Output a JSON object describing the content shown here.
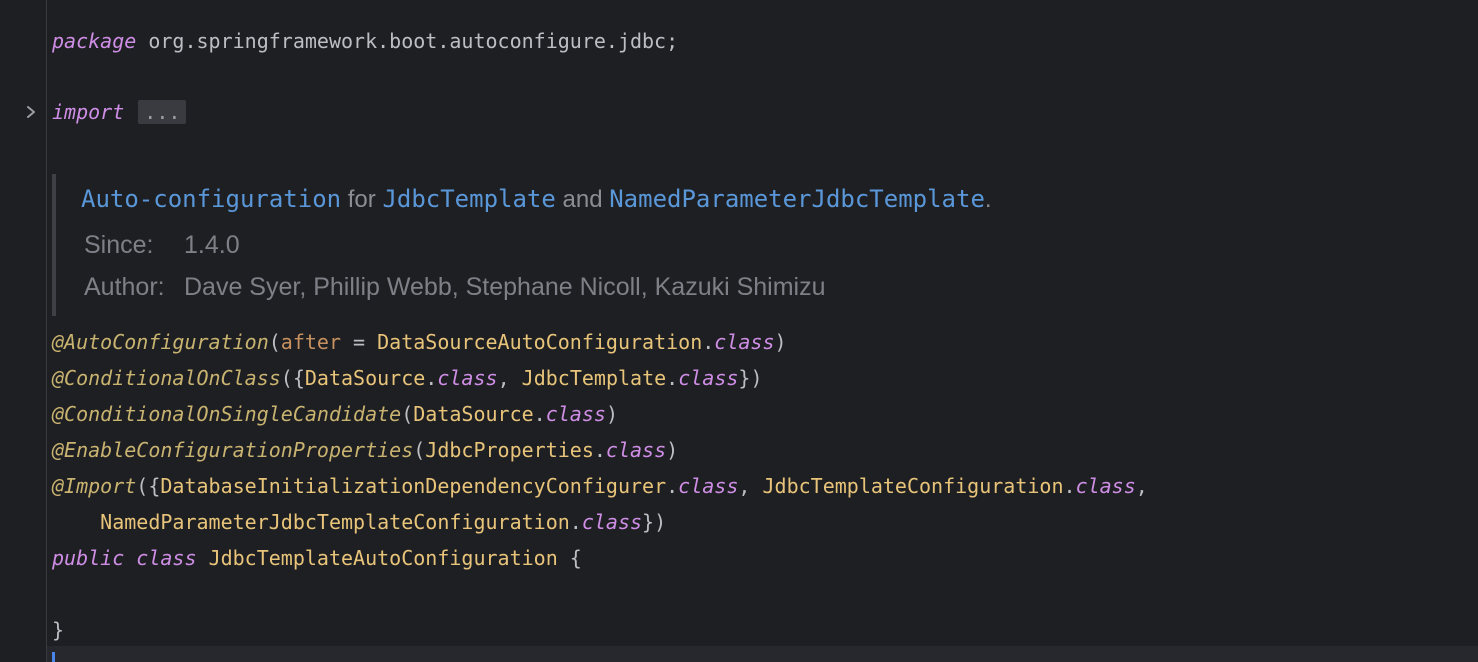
{
  "colors": {
    "background": "#1e1f22",
    "keyword": "#cf8ee6",
    "class": "#e8c47a",
    "annotation": "#c9b370",
    "parameter": "#c79060",
    "doc_link": "#5a97d9",
    "doc_text": "#8a8d93",
    "caret": "#4a86e8"
  },
  "code": {
    "package_line": {
      "keyword": "package",
      "name": " org.springframework.boot.autoconfigure.jdbc;"
    },
    "import_line": {
      "keyword": "import",
      "folded": "...",
      "fold_icon": "chevron-right-icon"
    },
    "doc": {
      "link1": "Auto-configuration",
      "text1": " for ",
      "link2": "JdbcTemplate",
      "text2": " and ",
      "link3": "NamedParameterJdbcTemplate",
      "text3": ".",
      "since_label": "Since:",
      "since_value": "1.4.0",
      "author_label": "Author:",
      "author_value": "Dave Syer, Phillip Webb, Stephane Nicoll, Kazuki Shimizu"
    },
    "ann1": {
      "name": "@AutoConfiguration",
      "open": "(",
      "param": "after",
      "eq": " = ",
      "cls": "DataSourceAutoConfiguration",
      "dot": ".",
      "kw": "class",
      "close": ")"
    },
    "ann2": {
      "name": "@ConditionalOnClass",
      "open": "({",
      "cls1": "DataSource",
      "dot1": ".",
      "kw1": "class",
      "sep": ", ",
      "cls2": "JdbcTemplate",
      "dot2": ".",
      "kw2": "class",
      "close": "})"
    },
    "ann3": {
      "name": "@ConditionalOnSingleCandidate",
      "open": "(",
      "cls": "DataSource",
      "dot": ".",
      "kw": "class",
      "close": ")"
    },
    "ann4": {
      "name": "@EnableConfigurationProperties",
      "open": "(",
      "cls": "JdbcProperties",
      "dot": ".",
      "kw": "class",
      "close": ")"
    },
    "ann5": {
      "name": "@Import",
      "open": "({",
      "cls1": "DatabaseInitializationDependencyConfigurer",
      "dot1": ".",
      "kw1": "class",
      "sep": ", ",
      "cls2": "JdbcTemplateConfiguration",
      "dot2": ".",
      "kw2": "class",
      "trail": ","
    },
    "ann5_cont": {
      "indent": "    ",
      "cls": "NamedParameterJdbcTemplateConfiguration",
      "dot": ".",
      "kw": "class",
      "close": "})"
    },
    "class_decl": {
      "kw1": "public",
      "kw2": "class",
      "name": "JdbcTemplateAutoConfiguration",
      "brace": " {"
    },
    "close_brace": "}"
  }
}
